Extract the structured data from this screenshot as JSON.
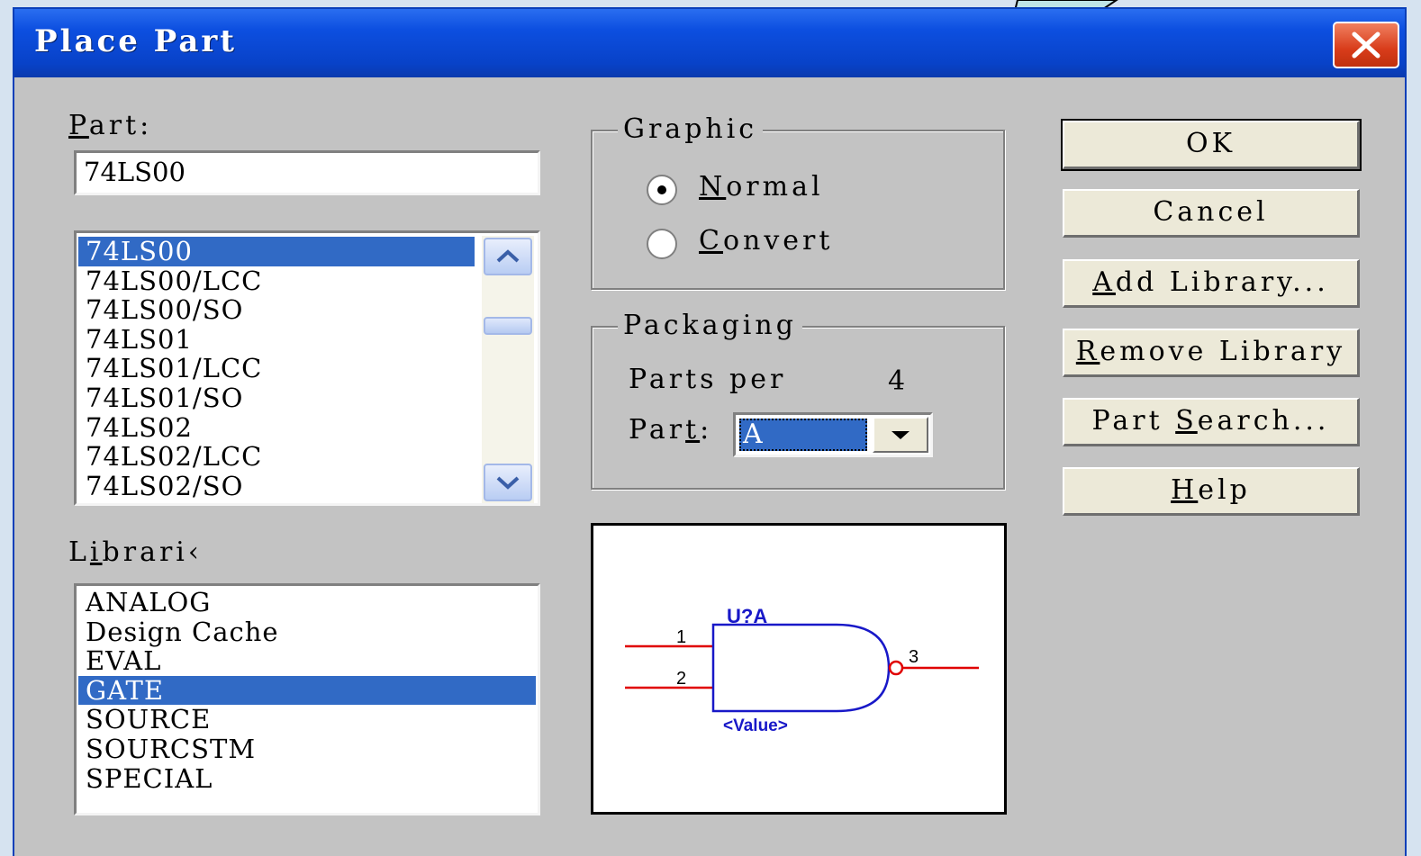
{
  "window": {
    "title": "Place Part"
  },
  "part": {
    "label_u": "P",
    "label_rest": "art:",
    "value": "74LS00"
  },
  "parts_list": [
    "74LS00",
    "74LS00/LCC",
    "74LS00/SO",
    "74LS01",
    "74LS01/LCC",
    "74LS01/SO",
    "74LS02",
    "74LS02/LCC",
    "74LS02/SO"
  ],
  "libraries": {
    "label_pre": "L",
    "label_u": "i",
    "label_rest": "brari‹",
    "items": [
      "ANALOG",
      "Design Cache",
      "EVAL",
      "GATE",
      "SOURCE",
      "SOURCSTM",
      "SPECIAL"
    ]
  },
  "graphic": {
    "title": "Graphic",
    "normal_u": "N",
    "normal_rest": "ormal",
    "convert_u": "C",
    "convert_rest": "onvert"
  },
  "packaging": {
    "title": "Packaging",
    "parts_per_label": "Parts per",
    "parts_per_value": "4",
    "part_label_pre": "Par",
    "part_label_u": "t",
    "part_label_rest": ":",
    "part_value": "A"
  },
  "buttons": {
    "ok": "OK",
    "cancel": "Cancel",
    "add_library_u": "A",
    "add_library_rest": "dd Library...",
    "remove_library_u": "R",
    "remove_library_rest": "emove Library",
    "part_search_pre": "Part ",
    "part_search_u": "S",
    "part_search_rest": "earch...",
    "help_u": "H",
    "help_rest": "elp"
  },
  "preview": {
    "ref": "U?A",
    "value": "<Value>",
    "pin1": "1",
    "pin2": "2",
    "pin3": "3"
  },
  "colors": {
    "selection": "#316ac5",
    "wire": "#e00000",
    "gate": "#1818c8"
  }
}
